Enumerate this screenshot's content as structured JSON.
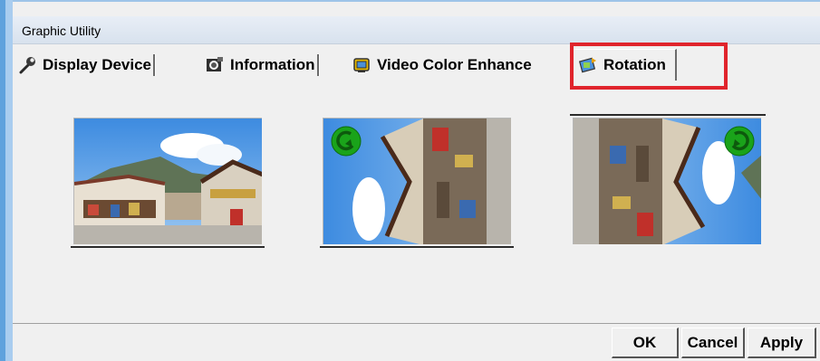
{
  "window": {
    "title": "Graphic Utility"
  },
  "tabs": [
    {
      "label": "Display Device",
      "icon": "wrench-icon",
      "active": false
    },
    {
      "label": "Information",
      "icon": "information-icon",
      "active": false
    },
    {
      "label": "Video Color Enhance",
      "icon": "video-color-icon",
      "active": false
    },
    {
      "label": "Rotation",
      "icon": "rotation-icon",
      "active": true
    }
  ],
  "rotation_options": [
    {
      "name": "rotate-0",
      "orientation": "normal"
    },
    {
      "name": "rotate-90-counterclockwise",
      "orientation": "rotated-left",
      "badge": "rotate-left-icon"
    },
    {
      "name": "rotate-90-clockwise",
      "orientation": "rotated-right",
      "badge": "rotate-right-icon"
    }
  ],
  "buttons": {
    "ok": "OK",
    "cancel": "Cancel",
    "apply": "Apply"
  },
  "colors": {
    "highlight": "#e0242c",
    "badge": "#1aa31a"
  }
}
